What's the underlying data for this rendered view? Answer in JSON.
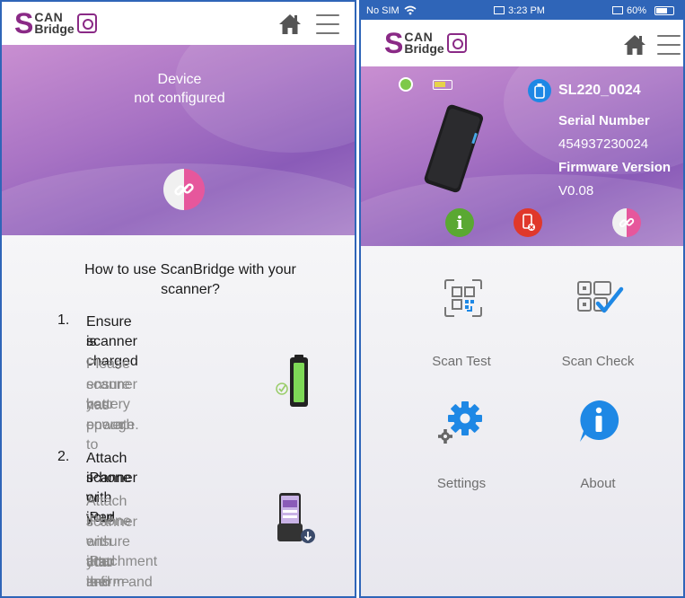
{
  "left": {
    "logo": {
      "letter": "S",
      "top": "CAN",
      "bottom": "Bridge"
    },
    "banner_line1": "Device",
    "banner_line2": "not configured",
    "howto_title": "How to use ScanBridge with your scanner?",
    "steps": [
      {
        "num": "1.",
        "title_lines": [
          "Ensure scanner",
          "is charged"
        ],
        "desc_lines": [
          "Please ensure your",
          "scanner has enough",
          "battery power to",
          "operate."
        ]
      },
      {
        "num": "2.",
        "title_lines": [
          "Attach scanner with your",
          "iPhone or iPad"
        ],
        "desc_lines": [
          "Attach scanner with your",
          "iPhone or iPad and",
          "ensure that the",
          "attachment is firm and",
          "secure."
        ]
      }
    ]
  },
  "right": {
    "status": {
      "carrier": "No SIM",
      "time": "3:23 PM",
      "battery": "60%"
    },
    "logo": {
      "letter": "S",
      "top": "CAN",
      "bottom": "Bridge"
    },
    "device_name": "SL220_0024",
    "serial_label": "Serial Number",
    "serial_value": "454937230024",
    "firmware_label": "Firmware Version",
    "firmware_value": "V0.08",
    "tiles": [
      {
        "label": "Scan Test"
      },
      {
        "label": "Scan Check"
      },
      {
        "label": "Settings"
      },
      {
        "label": "About"
      }
    ]
  },
  "colors": {
    "brand": "#8a2a86",
    "banner": "#a873c4",
    "link_pink": "#e6579c",
    "info_green": "#5aa832",
    "alert_red": "#e0382b",
    "accent_blue": "#1e88e5",
    "status_bar": "#2f65b8"
  }
}
